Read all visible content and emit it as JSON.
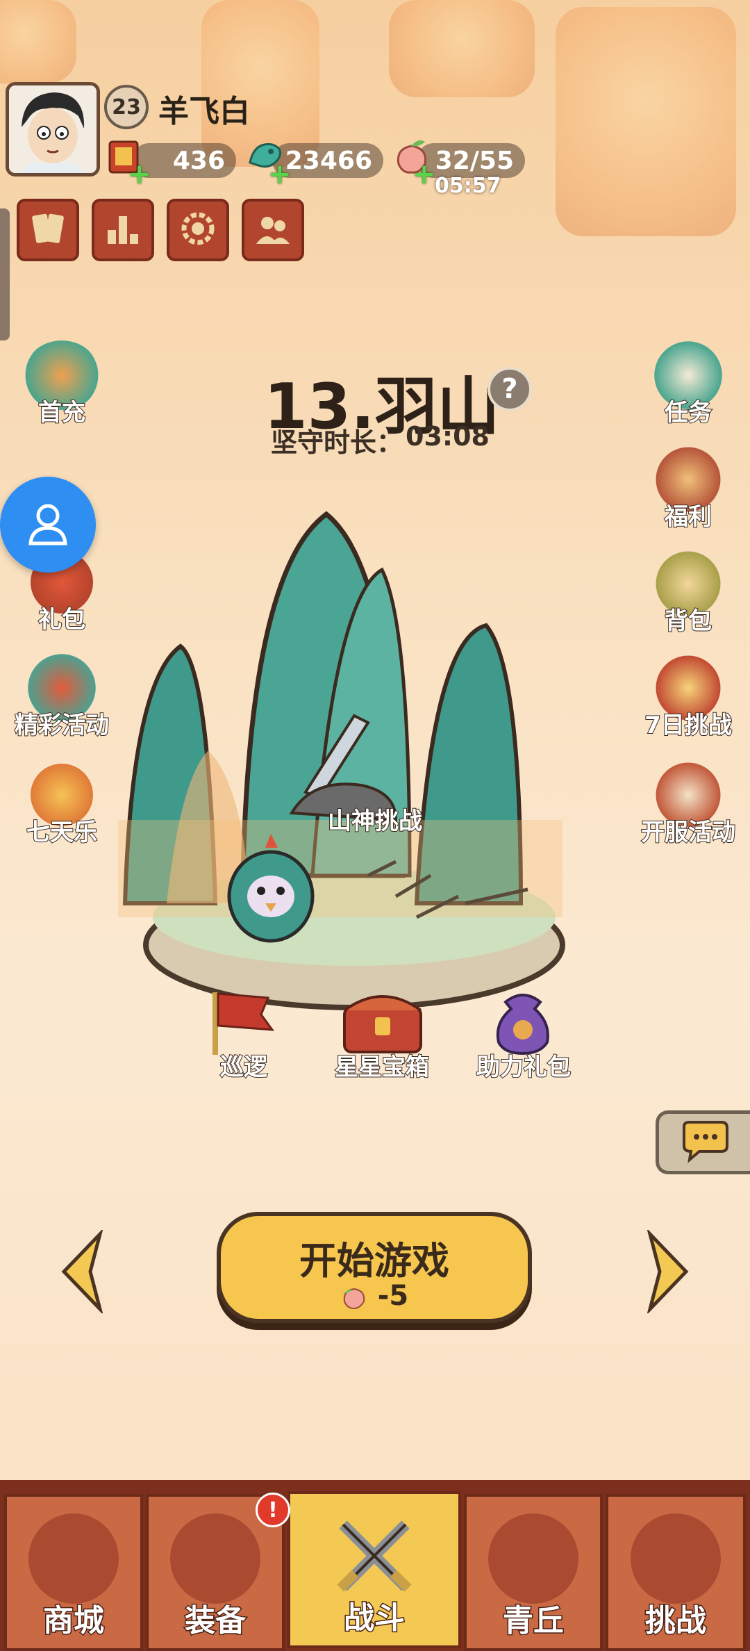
{
  "player": {
    "level": "23",
    "name": "羊飞白"
  },
  "resources": [
    {
      "name": "scroll",
      "icon": "scroll-ticket-icon",
      "value": "436"
    },
    {
      "name": "jade",
      "icon": "jade-dragon-icon",
      "value": "23466"
    },
    {
      "name": "peach",
      "icon": "peach-stamina-icon",
      "value": "32/55"
    }
  ],
  "stamina_timer": "05:57",
  "top_buttons": [
    {
      "icon": "cards-icon"
    },
    {
      "icon": "ranking-icon"
    },
    {
      "icon": "settings-gear-icon"
    },
    {
      "icon": "friends-icon"
    }
  ],
  "left_menu": [
    {
      "label": "首充"
    },
    {
      "label": "礼包"
    },
    {
      "label": "精彩活动"
    },
    {
      "label": "七天乐"
    }
  ],
  "right_menu": [
    {
      "label": "任务"
    },
    {
      "label": "福利"
    },
    {
      "label": "背包"
    },
    {
      "label": "7日挑战"
    },
    {
      "label": "开服活动"
    }
  ],
  "stage": {
    "title": "13.羽山",
    "hold_label": "坚守时长：",
    "hold_time": "03:08",
    "challenge_label": "山神挑战"
  },
  "scene_items": [
    {
      "label": "巡逻"
    },
    {
      "label": "星星宝箱"
    },
    {
      "label": "助力礼包"
    }
  ],
  "start": {
    "label": "开始游戏",
    "cost": "-5"
  },
  "nav_tabs": [
    {
      "label": "商城"
    },
    {
      "label": "装备"
    },
    {
      "label": "战斗",
      "active": true
    },
    {
      "label": "青丘"
    },
    {
      "label": "挑战"
    }
  ],
  "colors": {
    "accent": "#f3c954",
    "nav_bg": "#c96a45",
    "mountain": "#3f9a8c",
    "float_button": "#2f8ef2"
  }
}
